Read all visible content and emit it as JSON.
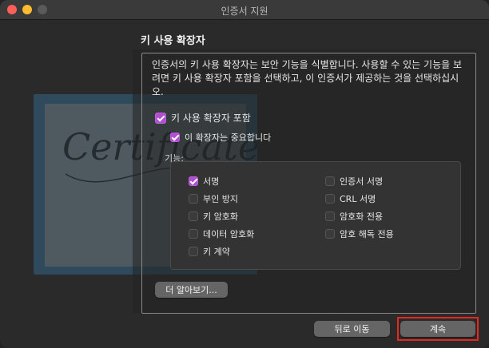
{
  "window": {
    "title": "인증서 지원"
  },
  "artwork": {
    "script_text": "Certificate"
  },
  "section": {
    "heading": "키 사용 확장자",
    "description": "인증서의 키 사용 확장자는 보안 기능을 식별합니다. 사용할 수 있는 기능을 보려면 키 사용 확장자 포함을 선택하고, 이 인증서가 제공하는 것을 선택하십시오."
  },
  "include_ext": {
    "label": "키 사용 확장자 포함",
    "checked": true
  },
  "critical": {
    "label": "이 확장자는 중요합니다",
    "checked": true
  },
  "uses": {
    "label": "기능:",
    "left": [
      {
        "label": "서명",
        "checked": true
      },
      {
        "label": "부인 방지",
        "checked": false
      },
      {
        "label": "키 암호화",
        "checked": false
      },
      {
        "label": "데이터 암호화",
        "checked": false
      },
      {
        "label": "키 계약",
        "checked": false
      }
    ],
    "right": [
      {
        "label": "인증서 서명",
        "checked": false
      },
      {
        "label": "CRL 서명",
        "checked": false
      },
      {
        "label": "암호화 전용",
        "checked": false
      },
      {
        "label": "암호 해독 전용",
        "checked": false
      }
    ]
  },
  "buttons": {
    "learn_more": "더 알아보기...",
    "back": "뒤로 이동",
    "continue": "계속"
  },
  "colors": {
    "accent": "#b04fd0",
    "highlight": "#e8281f"
  }
}
